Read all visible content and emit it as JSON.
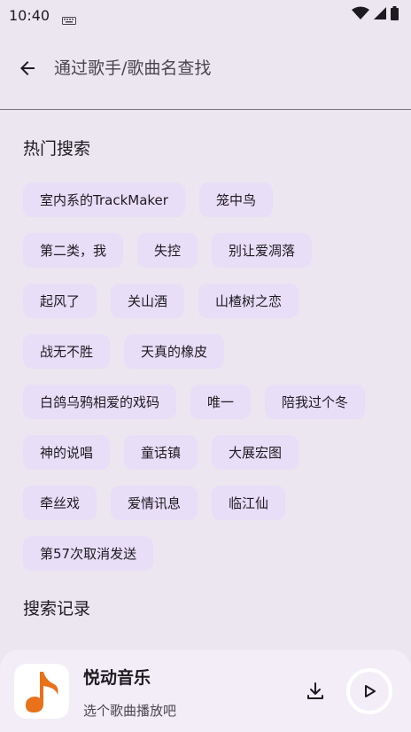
{
  "status_bar": {
    "time": "10:40",
    "icons": [
      "keyboard-icon",
      "wifi-icon",
      "signal-icon",
      "battery-icon"
    ]
  },
  "app_bar": {
    "back_icon": "arrow-back-icon",
    "search_placeholder": "通过歌手/歌曲名查找"
  },
  "hot_search": {
    "title": "热门搜索",
    "rows": [
      [
        "室内系的TrackMaker",
        "笼中鸟"
      ],
      [
        "第二类，我",
        "失控",
        "别让爱凋落"
      ],
      [
        "起风了",
        "关山酒",
        "山楂树之恋"
      ],
      [
        "战无不胜",
        "天真的橡皮"
      ],
      [
        "白鸽乌鸦相爱的戏码",
        "唯一",
        "陪我过个冬"
      ],
      [
        "神的说唱",
        "童话镇",
        "大展宏图"
      ],
      [
        "牵丝戏",
        "爱情讯息",
        "临江仙"
      ],
      [
        "第57次取消发送"
      ]
    ]
  },
  "history": {
    "title": "搜索记录"
  },
  "player": {
    "title": "悦动音乐",
    "subtitle": "选个歌曲播放吧",
    "accent_color": "#E8711A"
  },
  "colors": {
    "background": "#ECE6F0",
    "chip": "#E8DEF8",
    "player_bg": "#F3EDF7"
  }
}
